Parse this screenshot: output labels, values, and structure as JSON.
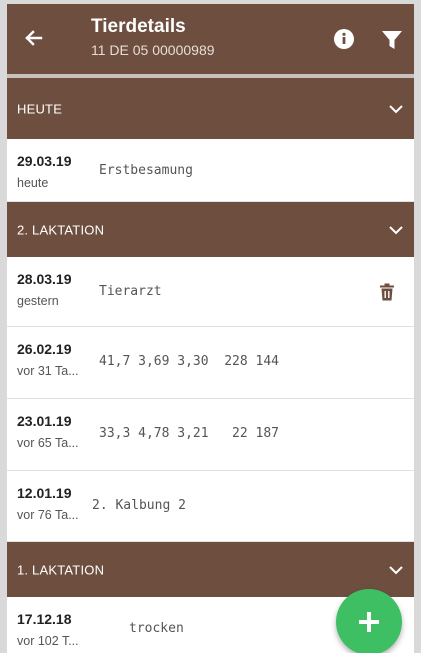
{
  "appbar": {
    "title": "Tierdetails",
    "subtitle": "11 DE 05 00000989",
    "icons": [
      "back-arrow-icon",
      "info-icon",
      "filter-icon"
    ]
  },
  "sections": [
    {
      "label": "HEUTE",
      "rows": [
        {
          "date": "29.03.19",
          "relative": "heute",
          "value": "Erstbesamung"
        }
      ]
    },
    {
      "label": "2. LAKTATION",
      "rows": [
        {
          "date": "28.03.19",
          "relative": "gestern",
          "value": "Tierarzt",
          "action_icon": "trash-icon"
        },
        {
          "date": "26.02.19",
          "relative": "vor 31 Ta...",
          "value": "41,7 3,69 3,30  228 144"
        },
        {
          "date": "23.01.19",
          "relative": "vor 65 Ta...",
          "value": "33,3 4,78 3,21   22 187"
        },
        {
          "date": "12.01.19",
          "relative": "vor 76 Ta...",
          "value": "2. Kalbung 2"
        }
      ]
    },
    {
      "label": "1. LAKTATION",
      "rows": [
        {
          "date": "17.12.18",
          "relative": "vor 102 T...",
          "value": "trocken"
        }
      ]
    }
  ],
  "fab": {
    "icon": "plus-icon"
  },
  "colors": {
    "brand": "#6e4e3f",
    "fab": "#3fbf63"
  }
}
